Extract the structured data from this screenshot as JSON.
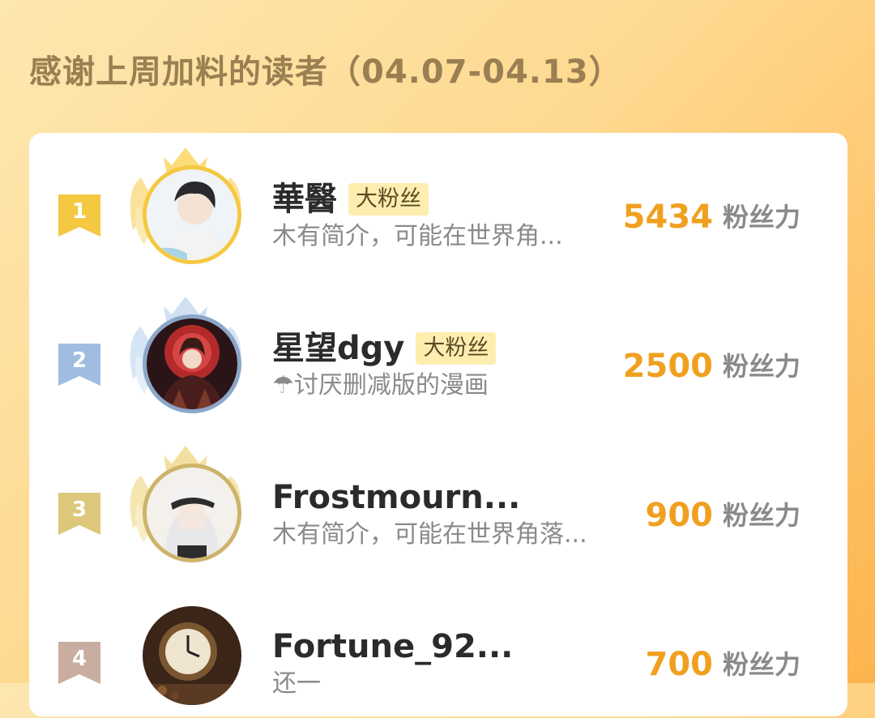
{
  "header": {
    "title": "感谢上周加料的读者（04.07-04.13）"
  },
  "leaderboard": {
    "score_unit": "粉丝力",
    "entries": [
      {
        "rank": "1",
        "name": "華醫",
        "tag": "大粉丝",
        "bio": "木有简介，可能在世界角...",
        "score": "5434"
      },
      {
        "rank": "2",
        "name": "星望dgy",
        "tag": "大粉丝",
        "bio": "☂讨厌删减版的漫画",
        "score": "2500"
      },
      {
        "rank": "3",
        "name": "Frostmourn...",
        "tag": "",
        "bio": "木有简介，可能在世界角落...",
        "score": "900"
      },
      {
        "rank": "4",
        "name": "Fortune_92...",
        "tag": "",
        "bio": "还一",
        "score": "700"
      }
    ]
  },
  "colors": {
    "gold": "#f5c842",
    "silver": "#9fbde0",
    "bronze": "#ddc77a",
    "rank4": "#c9ada0",
    "score": "#f0a020"
  }
}
